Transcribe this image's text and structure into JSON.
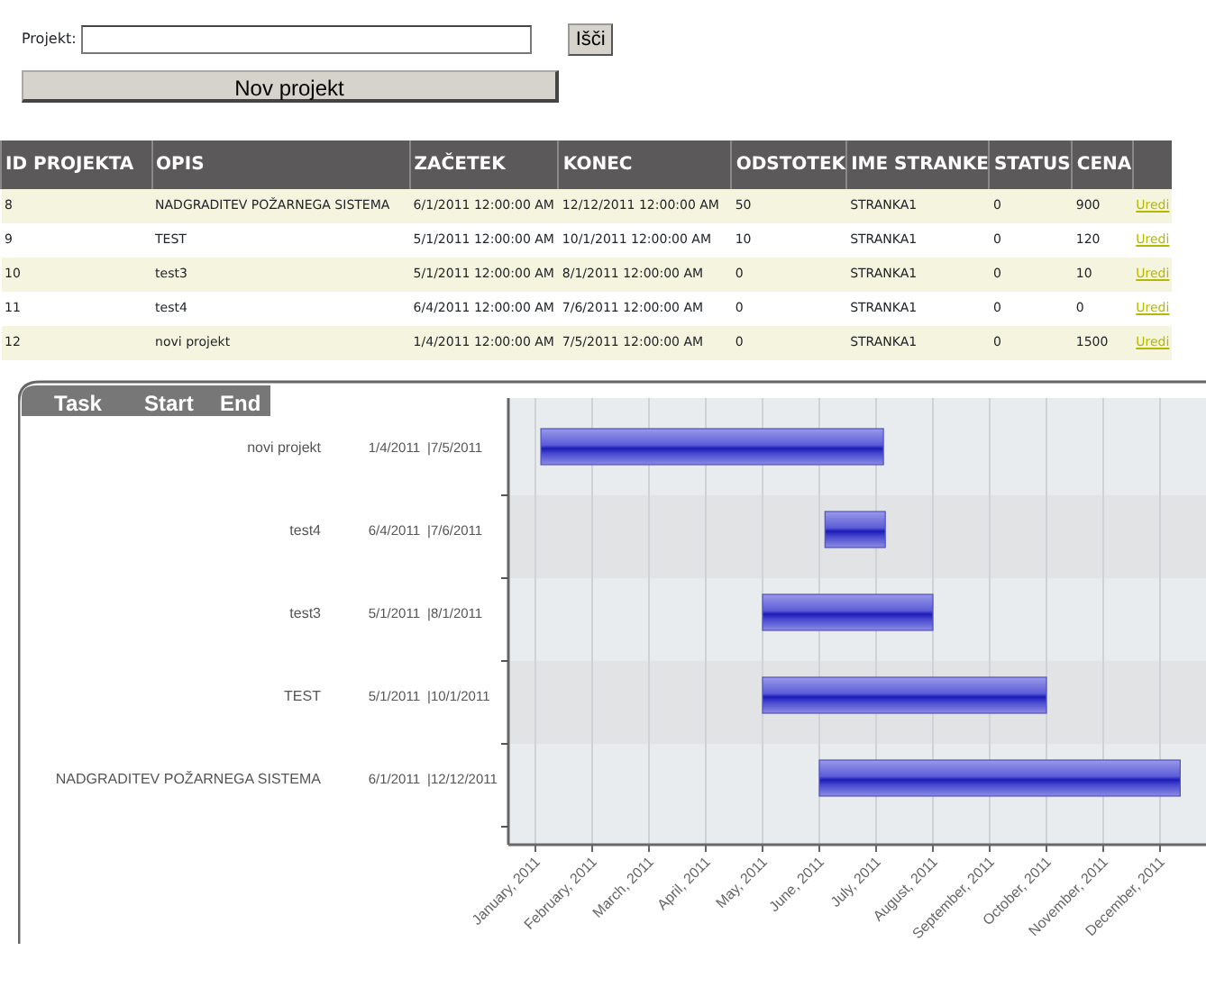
{
  "search": {
    "label": "Projekt:",
    "button": "Išči"
  },
  "new_button": "Nov projekt",
  "table": {
    "columns": [
      "ID PROJEKTA",
      "OPIS",
      "ZAČETEK",
      "KONEC",
      "ODSTOTEK",
      "IME STRANKE",
      "STATUS",
      "CENA"
    ],
    "rows": [
      {
        "cells": [
          "8",
          "NADGRADITEV POŽARNEGA SISTEMA",
          "6/1/2011 12:00:00 AM",
          "12/12/2011 12:00:00 AM",
          "50",
          "STRANKA1",
          "0",
          "900"
        ],
        "link": "Uredi"
      },
      {
        "cells": [
          "9",
          "TEST",
          "5/1/2011 12:00:00 AM",
          "10/1/2011 12:00:00 AM",
          "10",
          "STRANKA1",
          "0",
          "120"
        ],
        "link": "Uredi"
      },
      {
        "cells": [
          "10",
          "test3",
          "5/1/2011 12:00:00 AM",
          "8/1/2011 12:00:00 AM",
          "0",
          "STRANKA1",
          "0",
          "10"
        ],
        "link": "Uredi"
      },
      {
        "cells": [
          "11",
          "test4",
          "6/4/2011 12:00:00 AM",
          "7/6/2011 12:00:00 AM",
          "0",
          "STRANKA1",
          "0",
          "0"
        ],
        "link": "Uredi"
      },
      {
        "cells": [
          "12",
          "novi projekt",
          "1/4/2011 12:00:00 AM",
          "7/5/2011 12:00:00 AM",
          "0",
          "STRANKA1",
          "0",
          "1500"
        ],
        "link": "Uredi"
      }
    ]
  },
  "gantt": {
    "columns": [
      "Task",
      "Start",
      "End"
    ],
    "tasks": [
      {
        "name": "novi projekt",
        "start": "1/4/2011",
        "end": "|7/5/2011"
      },
      {
        "name": "test4",
        "start": "6/4/2011",
        "end": "|7/6/2011"
      },
      {
        "name": "test3",
        "start": "5/1/2011",
        "end": "|8/1/2011"
      },
      {
        "name": "TEST",
        "start": "5/1/2011",
        "end": "|10/1/2011"
      },
      {
        "name": "NADGRADITEV POŽARNEGA SISTEMA",
        "start": "6/1/2011",
        "end": "|12/12/2011"
      }
    ],
    "months": [
      "January, 2011",
      "February, 2011",
      "March, 2011",
      "April, 2011",
      "May, 2011",
      "June, 2011",
      "July, 2011",
      "August, 2011",
      "September, 2011",
      "October, 2011",
      "November, 2011",
      "December, 2011"
    ]
  }
}
